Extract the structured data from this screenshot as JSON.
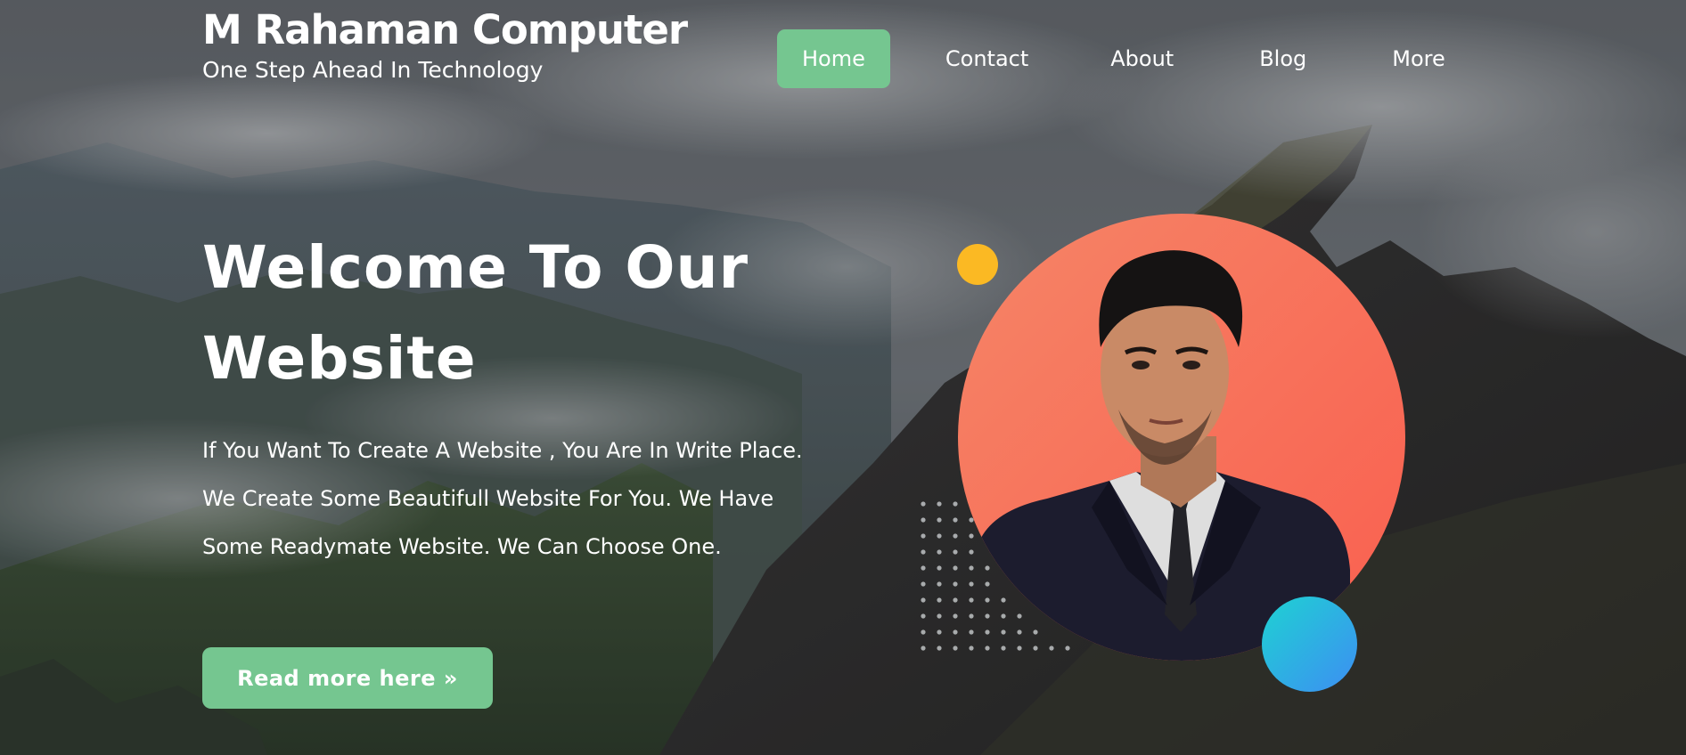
{
  "brand": {
    "title": "M Rahaman Computer",
    "tagline": "One Step Ahead In Technology"
  },
  "nav": {
    "items": [
      {
        "label": "Home",
        "active": true
      },
      {
        "label": "Contact",
        "active": false
      },
      {
        "label": "About",
        "active": false
      },
      {
        "label": "Blog",
        "active": false
      },
      {
        "label": "More",
        "active": false
      }
    ]
  },
  "hero": {
    "title_line1": "Welcome To Our",
    "title_line2": "Website",
    "description": "If You Want To Create A Website , You Are In Write Place. We Create Some Beautifull Website For You. We Have Some Readymate Website. We Can Choose One.",
    "cta_label": "Read more here »"
  },
  "colors": {
    "accent_green": "#75c690",
    "accent_yellow": "#fbb923",
    "portrait_bg": "#f8705a",
    "accent_blue": "#2bb0e6"
  }
}
